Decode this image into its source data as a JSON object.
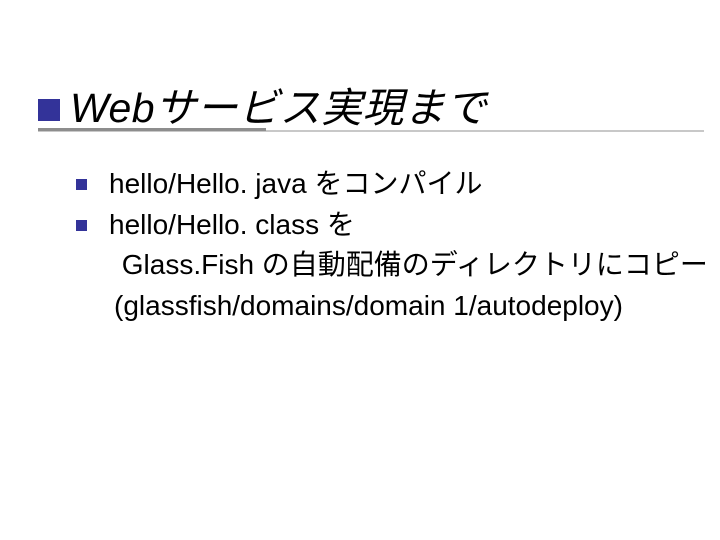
{
  "title": "Webサービス実現まで",
  "bullets": {
    "item1": "hello/Hello. java をコンパイル",
    "item2": "hello/Hello. class を"
  },
  "continuation": {
    "line1": " Glass.Fish の自動配備のディレクトリにコピー",
    "line2": "(glassfish/domains/domain 1/autodeploy)"
  },
  "colors": {
    "accent": "#333399"
  }
}
